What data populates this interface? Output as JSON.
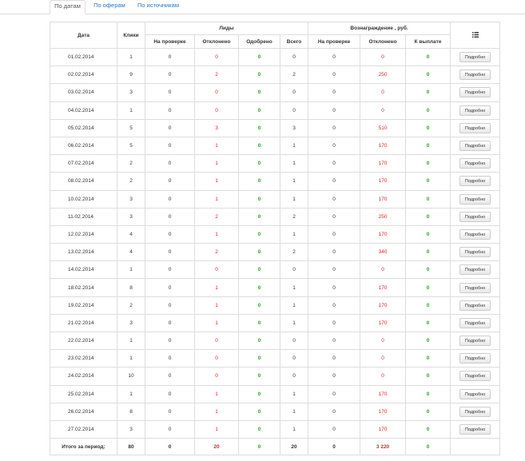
{
  "tabs": [
    "По датам",
    "По оферам",
    "По источникам"
  ],
  "header": {
    "date": "Дата",
    "clicks": "Клики",
    "leads_group": "Лиды",
    "reward_group": "Вознаграждение , руб.",
    "leads_cols": [
      "На проверке",
      "Отклонено",
      "Одобрено",
      "Всего"
    ],
    "reward_cols": [
      "На проверке",
      "Отклонено",
      "К выплате"
    ],
    "actions_icon": "list-icon"
  },
  "detail_label": "Подробно",
  "rows": [
    {
      "date": "01.02.2014",
      "clicks": "1",
      "lp": "0",
      "lr": "0",
      "la": "0",
      "lt": "0",
      "rp": "0",
      "rr": "0",
      "rpay": "0"
    },
    {
      "date": "02.02.2014",
      "clicks": "9",
      "lp": "0",
      "lr": "2",
      "la": "0",
      "lt": "2",
      "rp": "0",
      "rr": "250",
      "rpay": "0"
    },
    {
      "date": "03.02.2014",
      "clicks": "3",
      "lp": "0",
      "lr": "0",
      "la": "0",
      "lt": "0",
      "rp": "0",
      "rr": "0",
      "rpay": "0"
    },
    {
      "date": "04.02.2014",
      "clicks": "1",
      "lp": "0",
      "lr": "0",
      "la": "0",
      "lt": "0",
      "rp": "0",
      "rr": "0",
      "rpay": "0"
    },
    {
      "date": "05.02.2014",
      "clicks": "5",
      "lp": "0",
      "lr": "3",
      "la": "0",
      "lt": "3",
      "rp": "0",
      "rr": "510",
      "rpay": "0"
    },
    {
      "date": "06.02.2014",
      "clicks": "5",
      "lp": "0",
      "lr": "1",
      "la": "0",
      "lt": "1",
      "rp": "0",
      "rr": "170",
      "rpay": "0"
    },
    {
      "date": "07.02.2014",
      "clicks": "2",
      "lp": "0",
      "lr": "1",
      "la": "0",
      "lt": "1",
      "rp": "0",
      "rr": "170",
      "rpay": "0"
    },
    {
      "date": "08.02.2014",
      "clicks": "2",
      "lp": "0",
      "lr": "1",
      "la": "0",
      "lt": "1",
      "rp": "0",
      "rr": "170",
      "rpay": "0"
    },
    {
      "date": "10.02.2014",
      "clicks": "3",
      "lp": "0",
      "lr": "1",
      "la": "0",
      "lt": "1",
      "rp": "0",
      "rr": "170",
      "rpay": "0"
    },
    {
      "date": "11.02.2014",
      "clicks": "3",
      "lp": "0",
      "lr": "2",
      "la": "0",
      "lt": "2",
      "rp": "0",
      "rr": "250",
      "rpay": "0"
    },
    {
      "date": "12.02.2014",
      "clicks": "4",
      "lp": "0",
      "lr": "1",
      "la": "0",
      "lt": "1",
      "rp": "0",
      "rr": "170",
      "rpay": "0"
    },
    {
      "date": "13.02.2014",
      "clicks": "4",
      "lp": "0",
      "lr": "2",
      "la": "0",
      "lt": "2",
      "rp": "0",
      "rr": "340",
      "rpay": "0"
    },
    {
      "date": "14.02.2014",
      "clicks": "1",
      "lp": "0",
      "lr": "0",
      "la": "0",
      "lt": "0",
      "rp": "0",
      "rr": "0",
      "rpay": "0"
    },
    {
      "date": "18.02.2014",
      "clicks": "8",
      "lp": "0",
      "lr": "1",
      "la": "0",
      "lt": "1",
      "rp": "0",
      "rr": "170",
      "rpay": "0"
    },
    {
      "date": "19.02.2014",
      "clicks": "2",
      "lp": "0",
      "lr": "1",
      "la": "0",
      "lt": "1",
      "rp": "0",
      "rr": "170",
      "rpay": "0"
    },
    {
      "date": "21.02.2014",
      "clicks": "3",
      "lp": "0",
      "lr": "1",
      "la": "0",
      "lt": "1",
      "rp": "0",
      "rr": "170",
      "rpay": "0"
    },
    {
      "date": "22.02.2014",
      "clicks": "1",
      "lp": "0",
      "lr": "0",
      "la": "0",
      "lt": "0",
      "rp": "0",
      "rr": "0",
      "rpay": "0"
    },
    {
      "date": "23.02.2014",
      "clicks": "1",
      "lp": "0",
      "lr": "0",
      "la": "0",
      "lt": "0",
      "rp": "0",
      "rr": "0",
      "rpay": "0"
    },
    {
      "date": "24.02.2014",
      "clicks": "10",
      "lp": "0",
      "lr": "0",
      "la": "0",
      "lt": "0",
      "rp": "0",
      "rr": "0",
      "rpay": "0"
    },
    {
      "date": "25.02.2014",
      "clicks": "1",
      "lp": "0",
      "lr": "1",
      "la": "0",
      "lt": "1",
      "rp": "0",
      "rr": "170",
      "rpay": "0"
    },
    {
      "date": "26.02.2014",
      "clicks": "8",
      "lp": "0",
      "lr": "1",
      "la": "0",
      "lt": "1",
      "rp": "0",
      "rr": "170",
      "rpay": "0"
    },
    {
      "date": "27.02.2014",
      "clicks": "3",
      "lp": "0",
      "lr": "1",
      "la": "0",
      "lt": "1",
      "rp": "0",
      "rr": "170",
      "rpay": "0"
    }
  ],
  "totals": {
    "label": "Итого за период:",
    "clicks": "80",
    "lp": "0",
    "lr": "20",
    "la": "0",
    "lt": "20",
    "rp": "0",
    "rr": "3 220",
    "rpay": "0"
  },
  "colors": {
    "link": "#337ab7",
    "rejected": "#d9262a",
    "approved": "#2aa52a",
    "border": "#dddddd"
  }
}
